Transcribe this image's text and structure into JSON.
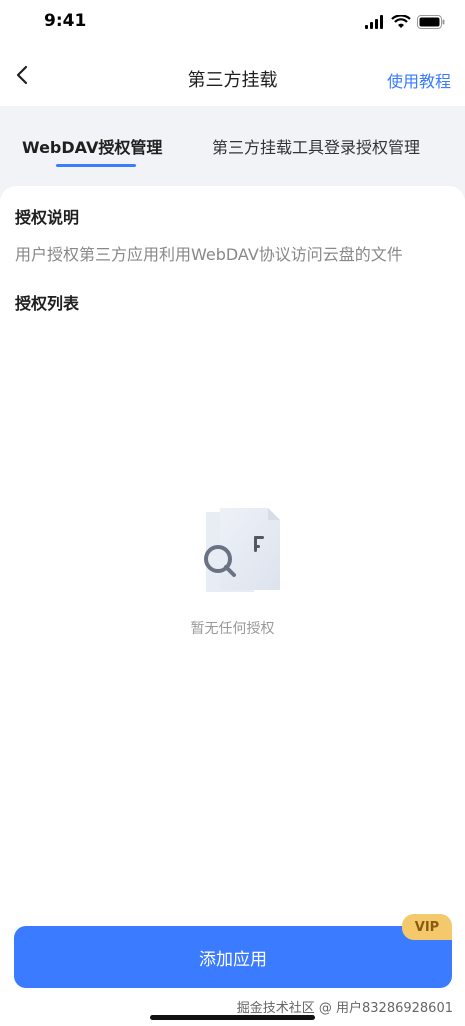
{
  "status_bar": {
    "time": "9:41"
  },
  "nav": {
    "title": "第三方挂载",
    "tutorial_link": "使用教程"
  },
  "tabs": [
    {
      "label": "WebDAV授权管理",
      "active": true
    },
    {
      "label": "第三方挂载工具登录授权管理",
      "active": false
    }
  ],
  "auth_info": {
    "title": "授权说明",
    "description": "用户授权第三方应用利用WebDAV协议访问云盘的文件"
  },
  "auth_list": {
    "title": "授权列表",
    "empty_text": "暂无任何授权"
  },
  "action": {
    "add_button_label": "添加应用",
    "badge": "VIP"
  },
  "watermark": "掘金技术社区 @ 用户83286928601",
  "colors": {
    "accent": "#3a7bff",
    "vip": "#f4c96b",
    "background": "#f2f3f7"
  }
}
